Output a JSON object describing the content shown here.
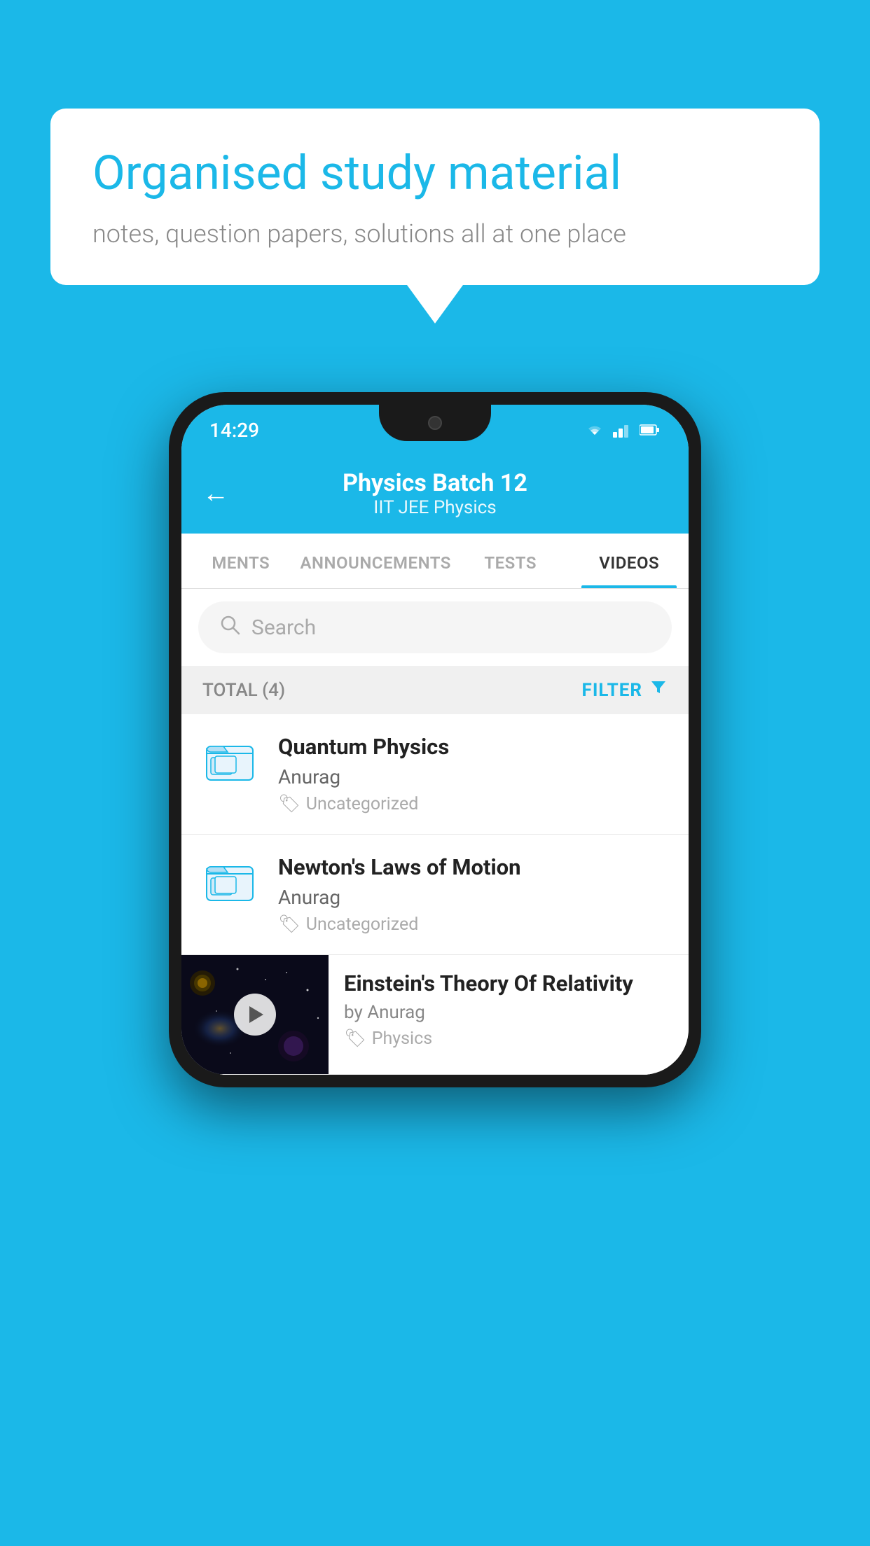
{
  "background_color": "#1BB8E8",
  "speech_bubble": {
    "title": "Organised study material",
    "subtitle": "notes, question papers, solutions all at one place"
  },
  "phone": {
    "status_bar": {
      "time": "14:29",
      "icons": [
        "wifi",
        "signal",
        "battery"
      ]
    },
    "header": {
      "back_label": "←",
      "title": "Physics Batch 12",
      "subtitle": "IIT JEE   Physics"
    },
    "tabs": [
      {
        "label": "MENTS",
        "active": false
      },
      {
        "label": "ANNOUNCEMENTS",
        "active": false
      },
      {
        "label": "TESTS",
        "active": false
      },
      {
        "label": "VIDEOS",
        "active": true
      }
    ],
    "search": {
      "placeholder": "Search"
    },
    "filter_bar": {
      "total_label": "TOTAL (4)",
      "filter_label": "FILTER"
    },
    "video_items": [
      {
        "id": 1,
        "title": "Quantum Physics",
        "author": "Anurag",
        "tag": "Uncategorized",
        "has_thumbnail": false
      },
      {
        "id": 2,
        "title": "Newton's Laws of Motion",
        "author": "Anurag",
        "tag": "Uncategorized",
        "has_thumbnail": false
      },
      {
        "id": 3,
        "title": "Einstein's Theory Of Relativity",
        "author": "by Anurag",
        "tag": "Physics",
        "has_thumbnail": true
      }
    ]
  }
}
